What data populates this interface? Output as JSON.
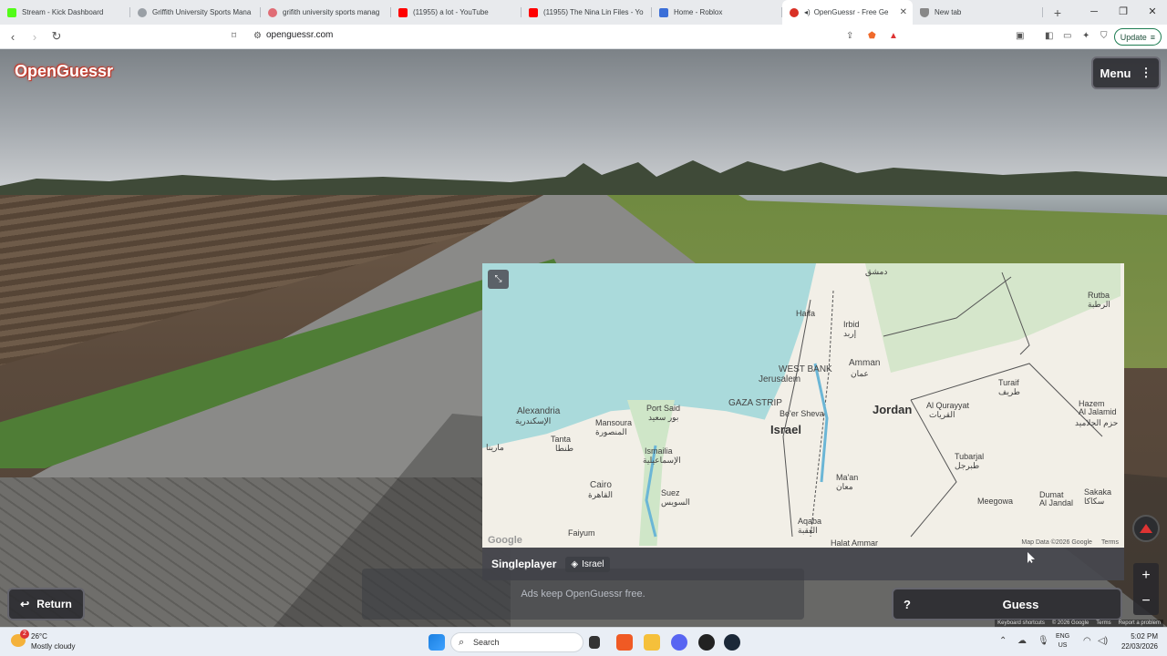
{
  "browser": {
    "tabs": [
      {
        "title": "Stream - Kick Dashboard",
        "color": "#53fc18"
      },
      {
        "title": "Griffith University Sports Mana",
        "color": "#777777"
      },
      {
        "title": "grifith university sports manag",
        "color": "#e06c75"
      },
      {
        "title": "(11955) a lot - YouTube",
        "color": "#ff0000"
      },
      {
        "title": "(11955) The Nina Lin Files - Yo",
        "color": "#ff0000"
      },
      {
        "title": "Home - Roblox",
        "color": "#3b6fd8"
      },
      {
        "title": "OpenGuessr - Free Ge",
        "color": "#d93025",
        "active": true
      },
      {
        "title": "New tab",
        "color": "#888888"
      }
    ],
    "url": "openguessr.com",
    "update_label": "Update"
  },
  "game": {
    "logo": "OpenGuessr",
    "menu_label": "Menu",
    "mode": "Singleplayer",
    "map_name": "Israel",
    "ads_text": "Ads keep OpenGuessr free.",
    "return_label": "Return",
    "help_label": "?",
    "guess_label": "Guess",
    "zoom_in": "+",
    "zoom_out": "−"
  },
  "map": {
    "labels": {
      "damascus": "دمشق",
      "rutba": "Rutba",
      "rutba_ar": "الرطبة",
      "haifa": "Haifa",
      "irbid": "Irbid",
      "irbid_ar": "إربد",
      "amman": "Amman",
      "amman_ar": "عمان",
      "west_bank": "WEST BANK",
      "jerusalem": "Jerusalem",
      "gaza": "GAZA STRIP",
      "israel": "Israel",
      "jordan": "Jordan",
      "beer_sheva": "Be'er Sheva",
      "alexandria": "Alexandria",
      "alexandria_ar": "الإسكندرية",
      "port_said": "Port Said",
      "port_said_ar": "بور سعيد",
      "mansoura": "Mansoura",
      "mansoura_ar": "المنصورة",
      "tanta": "Tanta",
      "tanta_ar": "طنطا",
      "ismailia": "Ismailia",
      "ismailia_ar": "الإسماعيلية",
      "cairo": "Cairo",
      "cairo_ar": "القاهرة",
      "suez": "Suez",
      "suez_ar": "السويس",
      "faiyum": "Faiyum",
      "al_qurayyat": "Al Qurayyat",
      "al_qurayyat_ar": "القريات",
      "turaif": "Turaif",
      "turaif_ar": "طريف",
      "hazem": "Hazem\nAl Jalamid",
      "hazem_ar": "حزم الجلاميد",
      "tubarjal": "Tubarjal",
      "tubarjal_ar": "طبرجل",
      "maan": "Ma'an",
      "maan_ar": "معان",
      "meegowa": "Meegowa",
      "dumat": "Dumat\nAl Jandal",
      "sakaka": "Sakaka",
      "sakaka_ar": "سكاكا",
      "aqaba": "Aqaba",
      "aqaba_ar": "العقبة",
      "halat_ammar": "Halat Ammar",
      "matruh_ar": "مارينا"
    },
    "attribution": "Map Data ©2026 Google",
    "terms": "Terms",
    "google": "Google",
    "keyboard": "Keyboard shortcuts",
    "data": "© 2026 Google",
    "terms2": "Terms",
    "report": "Report a problem"
  },
  "taskbar": {
    "temp": "26°C",
    "condition": "Mostly cloudy",
    "badge": "2",
    "search": "Search",
    "lang1": "ENG",
    "lang2": "US",
    "time": "5:02 PM",
    "date": "22/03/2026"
  }
}
